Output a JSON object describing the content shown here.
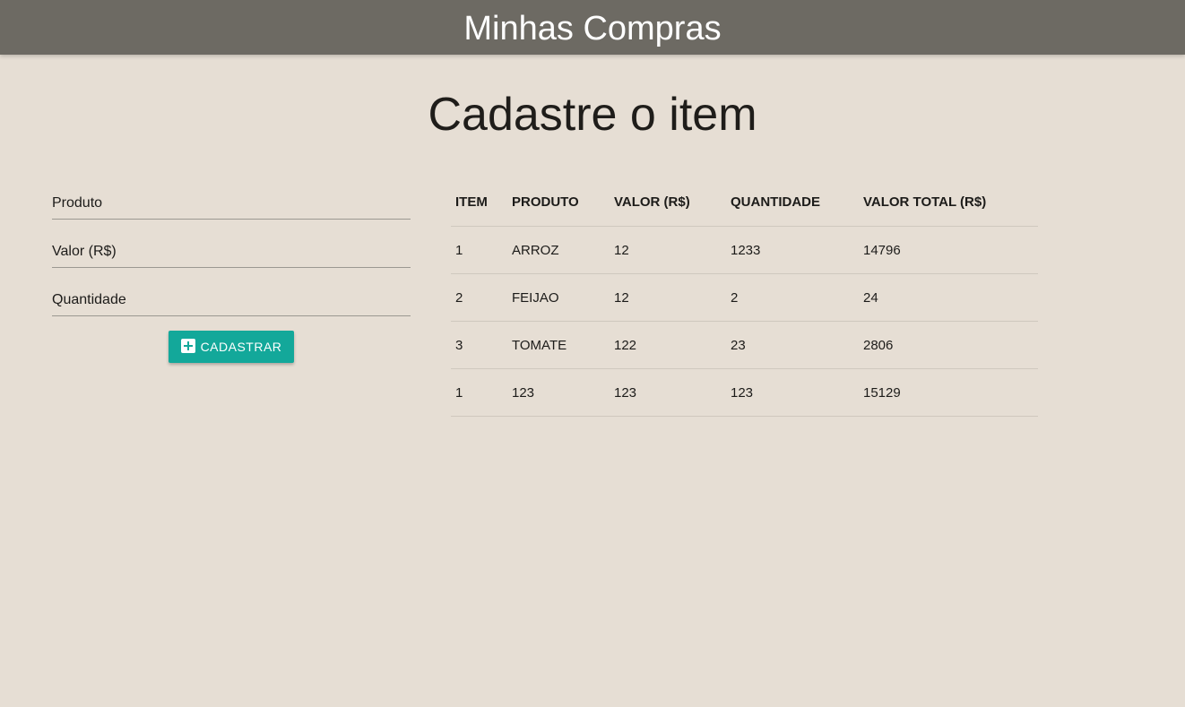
{
  "header": {
    "title": "Minhas Compras"
  },
  "page": {
    "heading": "Cadastre o item"
  },
  "form": {
    "fields": [
      {
        "placeholder": "Produto",
        "value": ""
      },
      {
        "placeholder": "Valor (R$)",
        "value": ""
      },
      {
        "placeholder": "Quantidade",
        "value": ""
      }
    ],
    "submit_label": "CADASTRAR",
    "submit_icon": "plus-box-icon"
  },
  "table": {
    "columns": [
      "ITEM",
      "PRODUTO",
      "VALOR (R$)",
      "QUANTIDADE",
      "VALOR TOTAL (R$)"
    ],
    "rows": [
      [
        "1",
        "ARROZ",
        "12",
        "1233",
        "14796"
      ],
      [
        "2",
        "FEIJAO",
        "12",
        "2",
        "24"
      ],
      [
        "3",
        "TOMATE",
        "122",
        "23",
        "2806"
      ],
      [
        "1",
        "123",
        "123",
        "123",
        "15129"
      ]
    ]
  },
  "colors": {
    "header_bg": "#6d6a63",
    "page_bg": "#e6ded4",
    "button_bg": "#13a89a"
  }
}
